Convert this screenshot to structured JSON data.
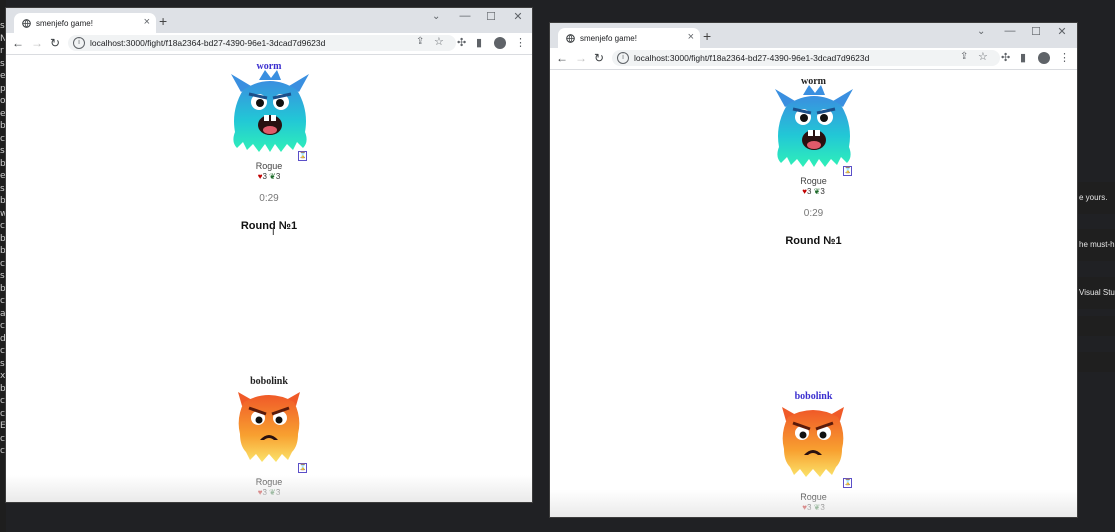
{
  "desktop": {
    "left_edge_text": "s\nN\nr\ns\ne\np\no\ne\nb\nc\ns\nb\ne\ns\nb\nw\nc\nb\nb\nc\ns\nb\nc\na\nc\nd\nc\ns\nx\nb\nc\nc\nE\nc\nc",
    "right_snippets": [
      "e yours.",
      "he must-ha",
      "Visual Stuc",
      "",
      ""
    ]
  },
  "windows": [
    {
      "tab_title": "smenjefo game!",
      "url": "localhost:3000/fight/f18a2364-bd27-4390-96e1-3dcad7d9623d",
      "top_player": {
        "name": "worm",
        "class": "Rogue",
        "hp": "3",
        "power": "3",
        "active": true
      },
      "timer": "0:29",
      "round": "Round №1",
      "bottom_player": {
        "name": "bobolink",
        "class": "Rogue",
        "hp": "3",
        "power": "3",
        "active": false
      }
    },
    {
      "tab_title": "smenjefo game!",
      "url": "localhost:3000/fight/f18a2364-bd27-4390-96e1-3dcad7d9623d",
      "top_player": {
        "name": "worm",
        "class": "Rogue",
        "hp": "3",
        "power": "3",
        "active": false
      },
      "timer": "0:29",
      "round": "Round №1",
      "bottom_player": {
        "name": "bobolink",
        "class": "Rogue",
        "hp": "3",
        "power": "3",
        "active": true
      }
    }
  ],
  "glyphs": {
    "heart": "♥",
    "leaf": "❦",
    "hourglass": "⌛",
    "close": "×",
    "new_tab": "+",
    "back": "←",
    "forward": "→",
    "reload": "↻",
    "menu": "⋮",
    "star": "☆",
    "share": "⇪",
    "puzzle": "✣",
    "sidepanel": "▮",
    "info": "i",
    "chevron": "⌄",
    "minimize": "—",
    "maximize": "☐",
    "window_close": "✕"
  }
}
